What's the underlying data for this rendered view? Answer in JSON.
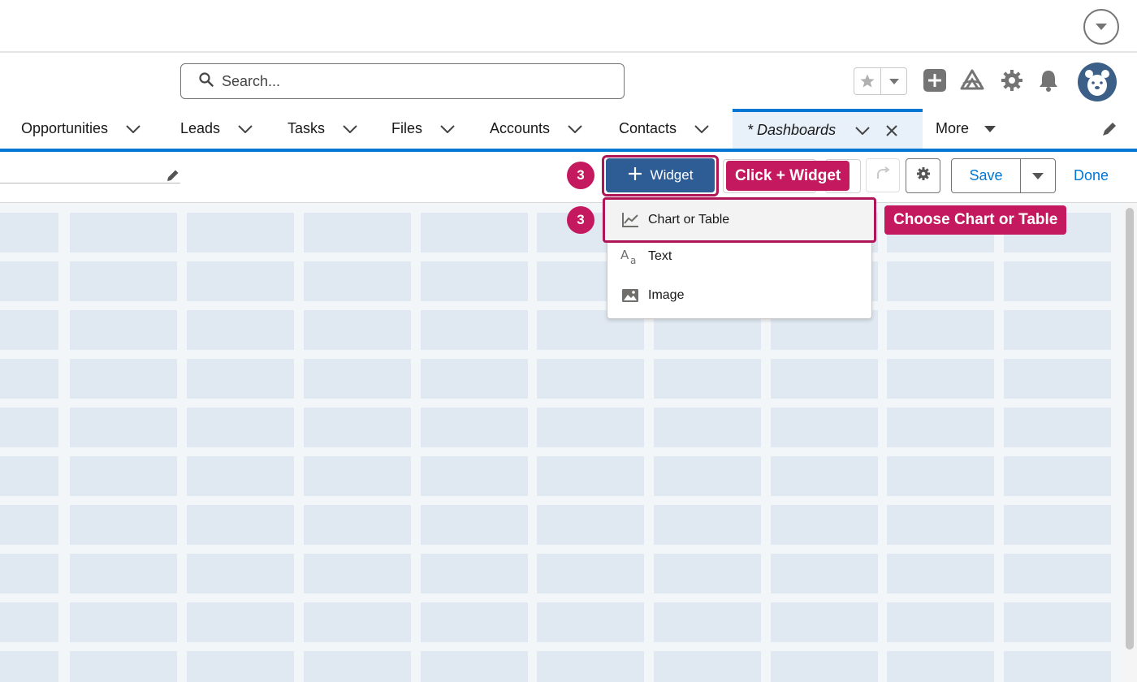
{
  "header": {
    "search_placeholder": "Search..."
  },
  "nav": {
    "tabs": [
      {
        "label": "Opportunities"
      },
      {
        "label": "Leads"
      },
      {
        "label": "Tasks"
      },
      {
        "label": "Files"
      },
      {
        "label": "Accounts"
      },
      {
        "label": "Contacts"
      },
      {
        "label": "* Dashboards",
        "active": true
      },
      {
        "label": "More"
      }
    ]
  },
  "toolbar": {
    "widget_label": "Widget",
    "save_label": "Save",
    "done_label": "Done"
  },
  "annotations": {
    "step_top": "3",
    "step_menu": "3",
    "callout_widget": "Click + Widget",
    "callout_chart": "Choose Chart or Table"
  },
  "widget_menu": {
    "items": [
      {
        "label": "Chart or Table",
        "icon": "line-chart-icon"
      },
      {
        "label": "Text",
        "icon": "text-icon"
      },
      {
        "label": "Image",
        "icon": "image-icon"
      }
    ]
  },
  "colors": {
    "brand_blue": "#0176d3",
    "widget_button": "#2e5d96",
    "annotation": "#c4185f",
    "grid_cell": "#e0e8f2"
  }
}
